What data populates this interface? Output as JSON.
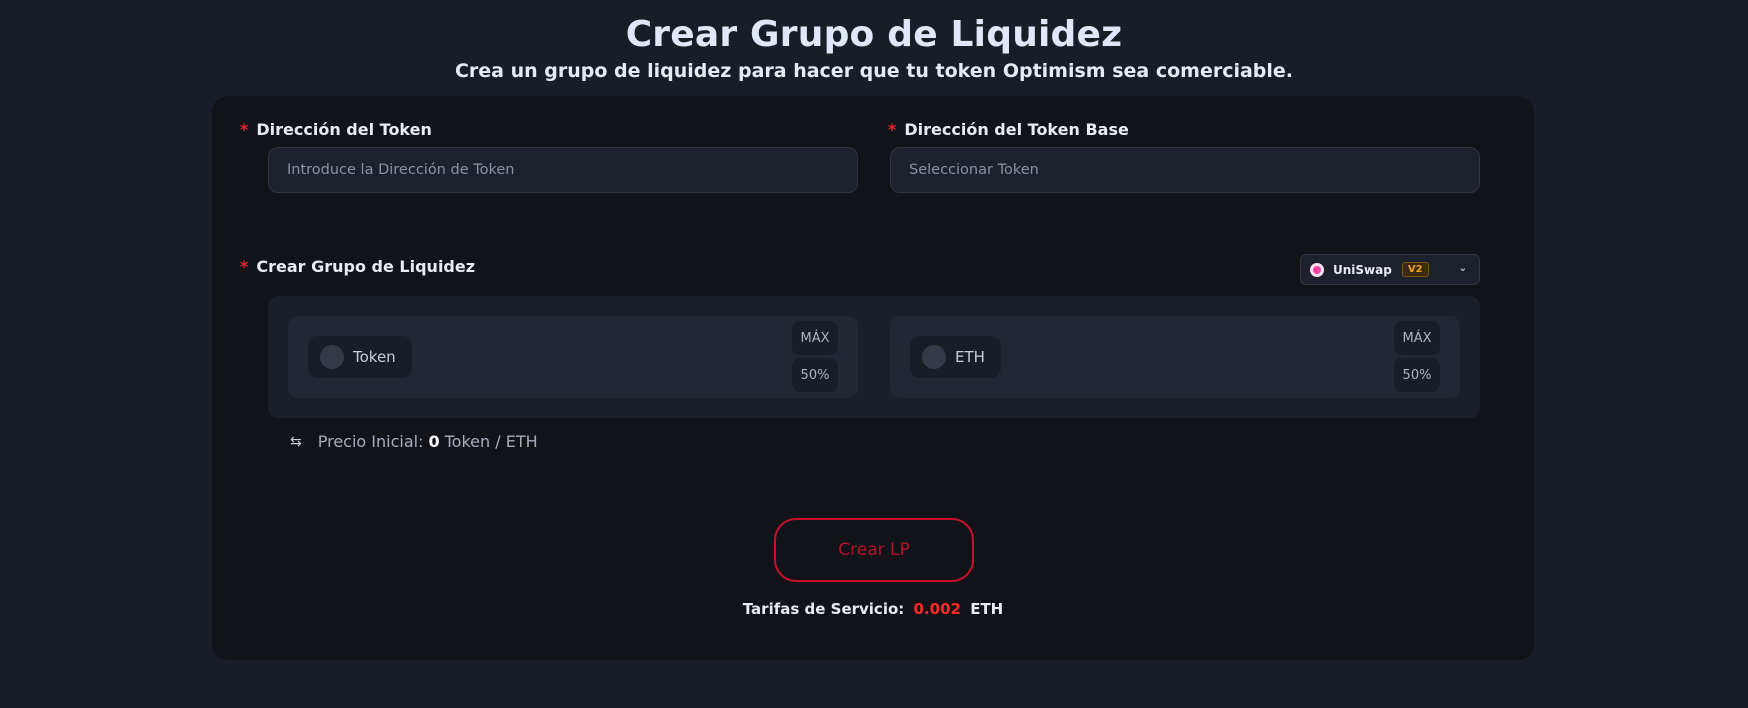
{
  "header": {
    "title": "Crear Grupo de Liquidez",
    "subtitle": "Crea un grupo de liquidez para hacer que tu token Optimism sea comerciable."
  },
  "form": {
    "required_mark": "*",
    "token_address": {
      "label": "Dirección del Token",
      "placeholder": "Introduce la Dirección de Token"
    },
    "base_token": {
      "label": "Dirección del Token Base",
      "placeholder": "Seleccionar Token"
    },
    "pool": {
      "label": "Crear Grupo de Liquidez",
      "dex_select": {
        "value": "UniSwap",
        "version": "V2",
        "icon": "uniswap-logo-icon"
      },
      "sides": [
        {
          "token": "Token",
          "max_label": "MÁX",
          "half_label": "50%"
        },
        {
          "token": "ETH",
          "max_label": "MÁX",
          "half_label": "50%"
        }
      ]
    },
    "initial_price": {
      "label": "Precio Inicial:",
      "value": "0",
      "pair": "Token / ETH"
    },
    "submit_label": "Crear LP",
    "fees": {
      "label": "Tarifas de Servicio:",
      "amount": "0.002",
      "unit": "ETH"
    }
  },
  "colors": {
    "background": "#181d27",
    "card": "#111318",
    "accent_red": "#c8102e",
    "fee_red": "#ff2a2a"
  }
}
